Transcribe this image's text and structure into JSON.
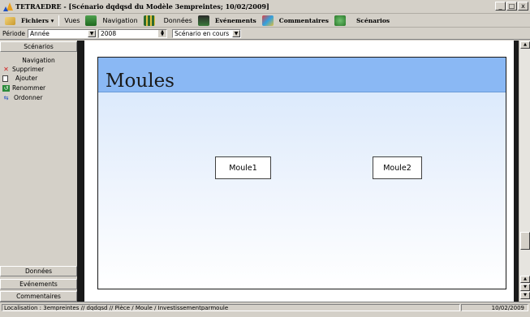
{
  "window": {
    "title": "TETRAEDRE - [Scénario dqdqsd du Modèle 3empreintes; 10/02/2009]",
    "minimize": "_",
    "restore": "□",
    "close": "x"
  },
  "menubar": {
    "fichiers": "Fichiers",
    "vues": "Vues",
    "navigation": "Navigation",
    "donnees": "Données",
    "evenements": "Evénements",
    "commentaires": "Commentaires",
    "scenarios": "Scénarios"
  },
  "periodbar": {
    "period_label": "Période",
    "period_value": "Année",
    "year_value": "2008",
    "scenario_value": "Scénario en cours"
  },
  "sidebar": {
    "scenarios_button": "Scénarios",
    "navigation_label": "Navigation",
    "items": [
      {
        "label": "Supprimer",
        "icon": "delete-x-icon"
      },
      {
        "label": "Ajouter",
        "icon": "add-document-icon"
      },
      {
        "label": "Renommer",
        "icon": "rename-icon"
      },
      {
        "label": "Ordonner",
        "icon": "order-icon"
      }
    ],
    "donnees_button": "Données",
    "evenements_button": "Evénements",
    "commentaires_button": "Commentaires"
  },
  "main": {
    "panel_title": "Moules",
    "nodes": [
      "Moule1",
      "Moule2"
    ]
  },
  "statusbar": {
    "location": "Localisation : 3empreintes // dqdqsd // Pièce / Moule / Investissementparmoule",
    "date": "10/02/2009"
  },
  "colors": {
    "panel_header": "#8ab8f4",
    "panel_gradient_top": "#d5e6fb",
    "chrome": "#d4d0c8"
  }
}
